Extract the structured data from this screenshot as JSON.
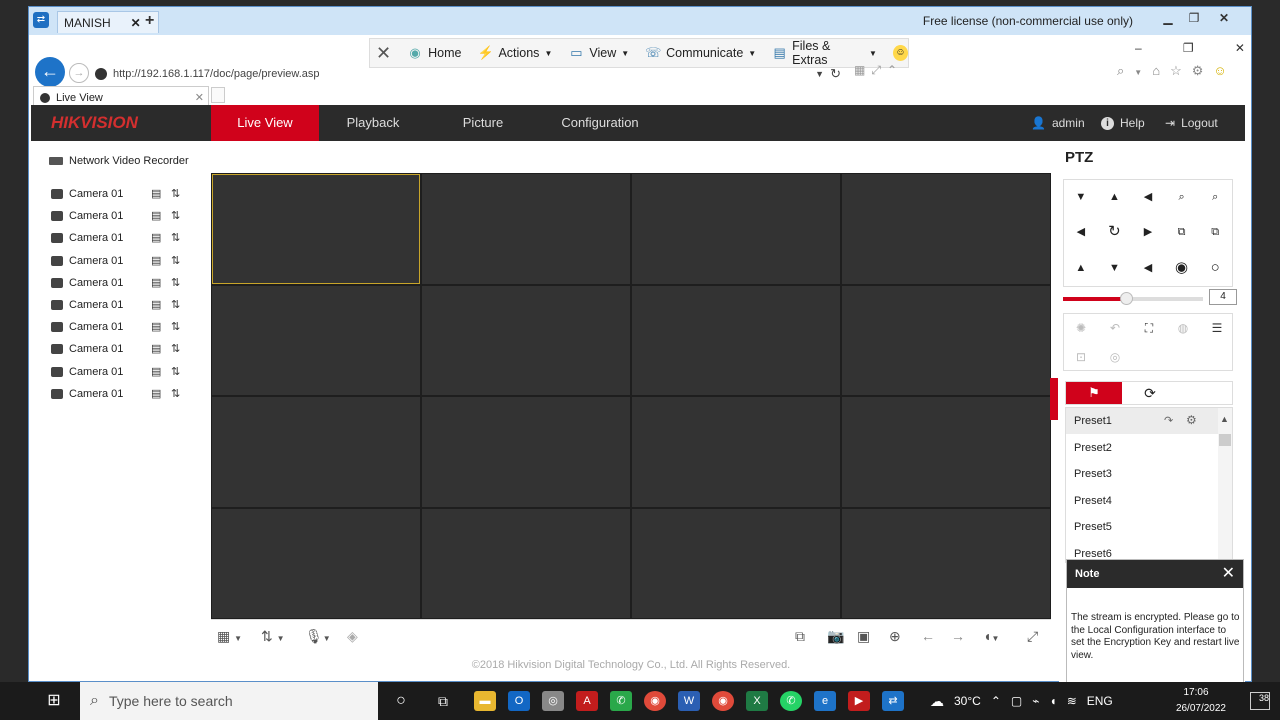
{
  "teamviewer": {
    "tab_label": "MANISH",
    "license": "Free license (non-commercial use only)",
    "toolbar": {
      "home": "Home",
      "actions": "Actions",
      "view": "View",
      "communicate": "Communicate",
      "files": "Files & Extras"
    }
  },
  "browser": {
    "url": "http://192.168.1.117/doc/page/preview.asp",
    "tab_title": "Live View"
  },
  "hik": {
    "logo": "HIKVISION",
    "nav": [
      "Live View",
      "Playback",
      "Picture",
      "Configuration"
    ],
    "user": "admin",
    "help": "Help",
    "logout": "Logout",
    "nvr_label": "Network Video Recorder",
    "cameras": [
      "Camera 01",
      "Camera 01",
      "Camera 01",
      "Camera 01",
      "Camera 01",
      "Camera 01",
      "Camera 01",
      "Camera 01",
      "Camera 01",
      "Camera 01"
    ],
    "copyright": "©2018 Hikvision Digital Technology Co., Ltd. All Rights Reserved.",
    "ptz": {
      "title": "PTZ",
      "speed": "4",
      "speed_fraction": 0.45,
      "presets": [
        "Preset1",
        "Preset2",
        "Preset3",
        "Preset4",
        "Preset5",
        "Preset6"
      ]
    },
    "note": {
      "title": "Note",
      "body": "The stream is encrypted. Please go to the Local Configuration interface to set the Encryption Key and restart live view."
    }
  },
  "taskbar": {
    "search_placeholder": "Type here to search",
    "weather": "30°C",
    "lang": "ENG",
    "time": "17:06",
    "date": "26/07/2022",
    "notifications": "38"
  },
  "colors": {
    "accent": "#d0021b",
    "header": "#2b2b2b",
    "selection": "#c8a52a"
  }
}
